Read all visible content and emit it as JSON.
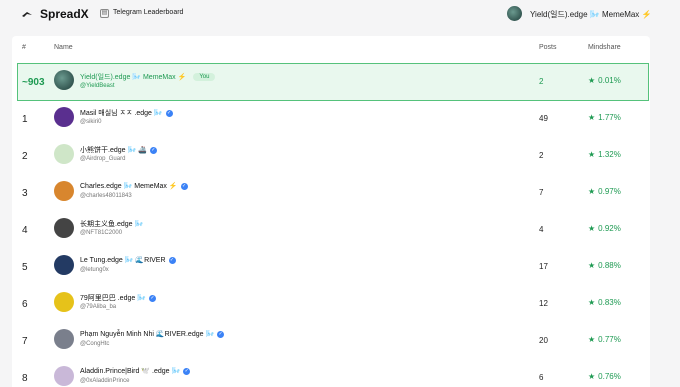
{
  "header": {
    "brand": "SpreadX",
    "breadcrumb": "Telegram Leaderboard",
    "user_name": "Yield(일드).edge 🌬️ MemeMax ⚡"
  },
  "table": {
    "columns": [
      "#",
      "Name",
      "Posts",
      "Mindshare"
    ],
    "me": {
      "rank": "~903",
      "name": "Yield(일드).edge 🌬️ MemeMax ⚡",
      "badge": "You",
      "handle": "@YieldBeast",
      "posts": "2",
      "mindshare": "0.01%"
    },
    "rows": [
      {
        "rank": "1",
        "name": "Masil 매실님 ㅈㅈ .edge 🌬️",
        "handle": "@sikiri0",
        "posts": "49",
        "mindshare": "1.77%",
        "verified": true,
        "avatar_color": "#5a2f8f"
      },
      {
        "rank": "2",
        "name": "小熊饼干.edge 🌬️ 🚢",
        "handle": "@Airdrop_Guard",
        "posts": "2",
        "mindshare": "1.32%",
        "verified": true,
        "avatar_color": "#cfe6c8"
      },
      {
        "rank": "3",
        "name": "Charles.edge 🌬️ MemeMax ⚡",
        "handle": "@charles48011843",
        "posts": "7",
        "mindshare": "0.97%",
        "verified": true,
        "avatar_color": "#d8862e"
      },
      {
        "rank": "4",
        "name": "长期主义鱼.edge 🌬️",
        "handle": "@NFT81C2000",
        "posts": "4",
        "mindshare": "0.92%",
        "verified": false,
        "avatar_color": "#444444"
      },
      {
        "rank": "5",
        "name": "Le Tung.edge 🌬️ 🌊RIVER",
        "handle": "@letung0x",
        "posts": "17",
        "mindshare": "0.88%",
        "verified": true,
        "avatar_color": "#233a63"
      },
      {
        "rank": "6",
        "name": "79阿里巴巴 .edge 🌬️",
        "handle": "@79Aliba_ba",
        "posts": "12",
        "mindshare": "0.83%",
        "verified": true,
        "avatar_color": "#e6c21a"
      },
      {
        "rank": "7",
        "name": "Phạm Nguyễn Minh Nhi 🌊RIVER.edge 🌬️",
        "handle": "@CongHtc",
        "posts": "20",
        "mindshare": "0.77%",
        "verified": true,
        "avatar_color": "#7a7f8c"
      },
      {
        "rank": "8",
        "name": "Aladdin.Prince|Bird 🕊️ .edge 🌬️",
        "handle": "@0xAladdinPrince",
        "posts": "6",
        "mindshare": "0.76%",
        "verified": true,
        "avatar_color": "#c9b8d8"
      }
    ]
  },
  "colors": {
    "accent_green": "#1e9a52",
    "verified_blue": "#3b82f6"
  }
}
